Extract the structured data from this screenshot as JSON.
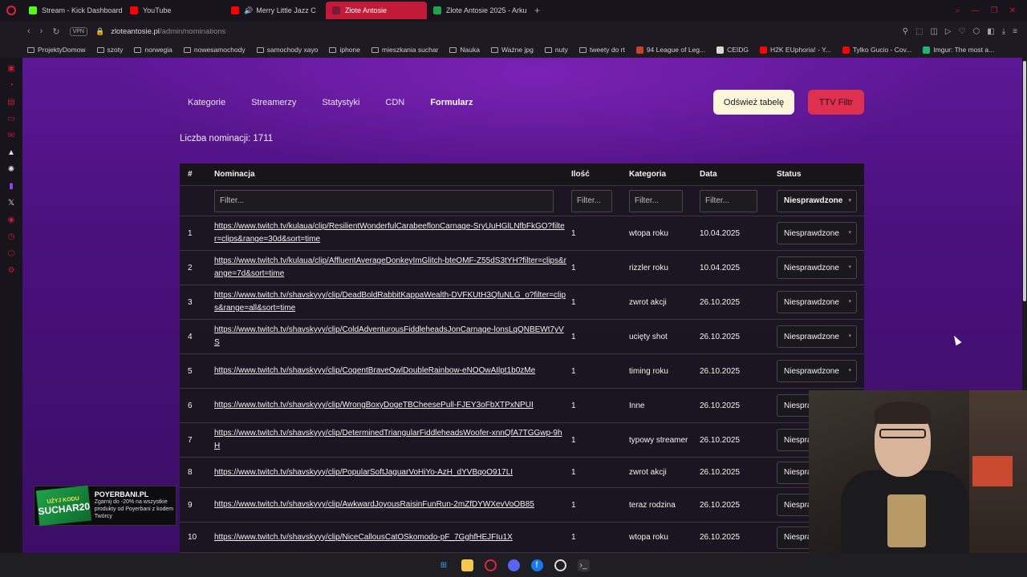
{
  "browser": {
    "tabs": [
      {
        "label": "Stream - Kick Dashboard",
        "color": "#53fc18"
      },
      {
        "label": "YouTube",
        "color": "#ff0000"
      },
      {
        "label": "Merry Little Jazz C",
        "color": "#ff0000"
      },
      {
        "label": "Złote Antosie",
        "color": "#7a1a3a",
        "active": true
      },
      {
        "label": "Złote Antosie 2025 - Arku",
        "color": "#1ea34a"
      }
    ],
    "url_host": "zloteantosie.pl",
    "url_path": "/admin/nominations",
    "vpn_label": "VPN",
    "bookmarks": [
      {
        "label": "ProjektyDomow",
        "type": "folder"
      },
      {
        "label": "szoty",
        "type": "folder"
      },
      {
        "label": "norwegia",
        "type": "folder"
      },
      {
        "label": "nowesamochody",
        "type": "folder"
      },
      {
        "label": "samochody xayo",
        "type": "folder"
      },
      {
        "label": "iphone",
        "type": "folder"
      },
      {
        "label": "mieszkania suchar",
        "type": "folder"
      },
      {
        "label": "Nauka",
        "type": "folder"
      },
      {
        "label": "Ważne jpg",
        "type": "folder"
      },
      {
        "label": "nuty",
        "type": "folder"
      },
      {
        "label": "tweety do rt",
        "type": "folder"
      },
      {
        "label": "94 League of Leg...",
        "type": "site",
        "color": "#c8402a"
      },
      {
        "label": "CEIDG",
        "type": "site",
        "color": "#d9d9d9"
      },
      {
        "label": "H2K EUphoria! - Y...",
        "type": "site",
        "color": "#ff0000"
      },
      {
        "label": "Tylko Gucio - Cov...",
        "type": "site",
        "color": "#ff0000"
      },
      {
        "label": "Imgur: The most a...",
        "type": "site",
        "color": "#1bb76e"
      }
    ]
  },
  "nav": {
    "items": [
      "Kategorie",
      "Streamerzy",
      "Statystyki",
      "CDN",
      "Formularz"
    ],
    "active": "Formularz"
  },
  "buttons": {
    "refresh": "Odśwież tabelę",
    "ttv": "TTV Filtr"
  },
  "count_label": "Liczba nominacji: 1711",
  "table": {
    "headers": {
      "num": "#",
      "nomination": "Nominacja",
      "count": "Ilość",
      "category": "Kategoria",
      "date": "Data",
      "status": "Status"
    },
    "filter_placeholder": "Filter...",
    "status_filter": "Niesprawdzone",
    "rows": [
      {
        "num": "1",
        "url": "https://www.twitch.tv/kulaua/clip/ResilientWonderfulCarabeeflonCarnage-SryUuHGlLNfbFkGO?filter=clips&range=30d&sort=time",
        "count": "1",
        "category": "wtopa roku",
        "date": "10.04.2025",
        "status": "Niesprawdzone"
      },
      {
        "num": "2",
        "url": "https://www.twitch.tv/kulaua/clip/AffluentAverageDonkeyImGlitch-bteOMF-Z55dS3tYH?filter=clips&range=7d&sort=time",
        "count": "1",
        "category": "rizzler roku",
        "date": "10.04.2025",
        "status": "Niesprawdzone"
      },
      {
        "num": "3",
        "url": "https://www.twitch.tv/shavskyyy/clip/DeadBoldRabbitKappaWealth-DVFKUtH3QfuNLG_o?filter=clips&range=all&sort=time",
        "count": "1",
        "category": "zwrot akcji",
        "date": "26.10.2025",
        "status": "Niesprawdzone"
      },
      {
        "num": "4",
        "url": "https://www.twitch.tv/shavskyyy/clip/ColdAdventurousFiddleheadsJonCarnage-lonsLqQNBEWt7yVS",
        "count": "1",
        "category": "ucięty shot",
        "date": "26.10.2025",
        "status": "Niesprawdzone"
      },
      {
        "num": "5",
        "url": "https://www.twitch.tv/shavskyyy/clip/CogentBraveOwlDoubleRainbow-eNOOwAIlpt1b0zMe",
        "count": "1",
        "category": "timing roku",
        "date": "26.10.2025",
        "status": "Niesprawdzone"
      },
      {
        "num": "6",
        "url": "https://www.twitch.tv/shavskyyy/clip/WrongBoxyDogeTBCheesePull-FJEY3oFbXTPxNPUI",
        "count": "1",
        "category": "Inne",
        "date": "26.10.2025",
        "status": "Niesprawdzone"
      },
      {
        "num": "7",
        "url": "https://www.twitch.tv/shavskyyy/clip/DeterminedTriangularFiddleheadsWoofer-xnnQfA7TGGwp-9hH",
        "count": "1",
        "category": "typowy streamer",
        "date": "26.10.2025",
        "status": "Niesprawdzone"
      },
      {
        "num": "8",
        "url": "https://www.twitch.tv/shavskyyy/clip/PopularSoftJaguarVoHiYo-AzH_dYVBqoO917LI",
        "count": "1",
        "category": "zwrot akcji",
        "date": "26.10.2025",
        "status": "Niesprawdzone"
      },
      {
        "num": "9",
        "url": "https://www.twitch.tv/shavskyyy/clip/AwkwardJoyousRaisinFunRun-2mZfDYWXevVoOB85",
        "count": "1",
        "category": "teraz rodzina",
        "date": "26.10.2025",
        "status": "Niesprawdzone"
      },
      {
        "num": "10",
        "url": "https://www.twitch.tv/shavskyyy/clip/NiceCallousCatOSkomodo-pF_7GghfHEJFIu1X",
        "count": "1",
        "category": "wtopa roku",
        "date": "26.10.2025",
        "status": "Niesprawdzone"
      }
    ]
  },
  "promo": {
    "code_label": "UŻYJ KODU",
    "code": "SUCHAR20",
    "brand": "POYERBANI.PL",
    "text": "Zgarnij do -20% na wszystkie produkty od Poyerbani z kodem Twórcy"
  },
  "colors": {
    "accent": "#c41a3a",
    "page_bg": "#4a117d",
    "refresh_bg": "#fdf6da",
    "ttv_bg": "#e0304f"
  }
}
